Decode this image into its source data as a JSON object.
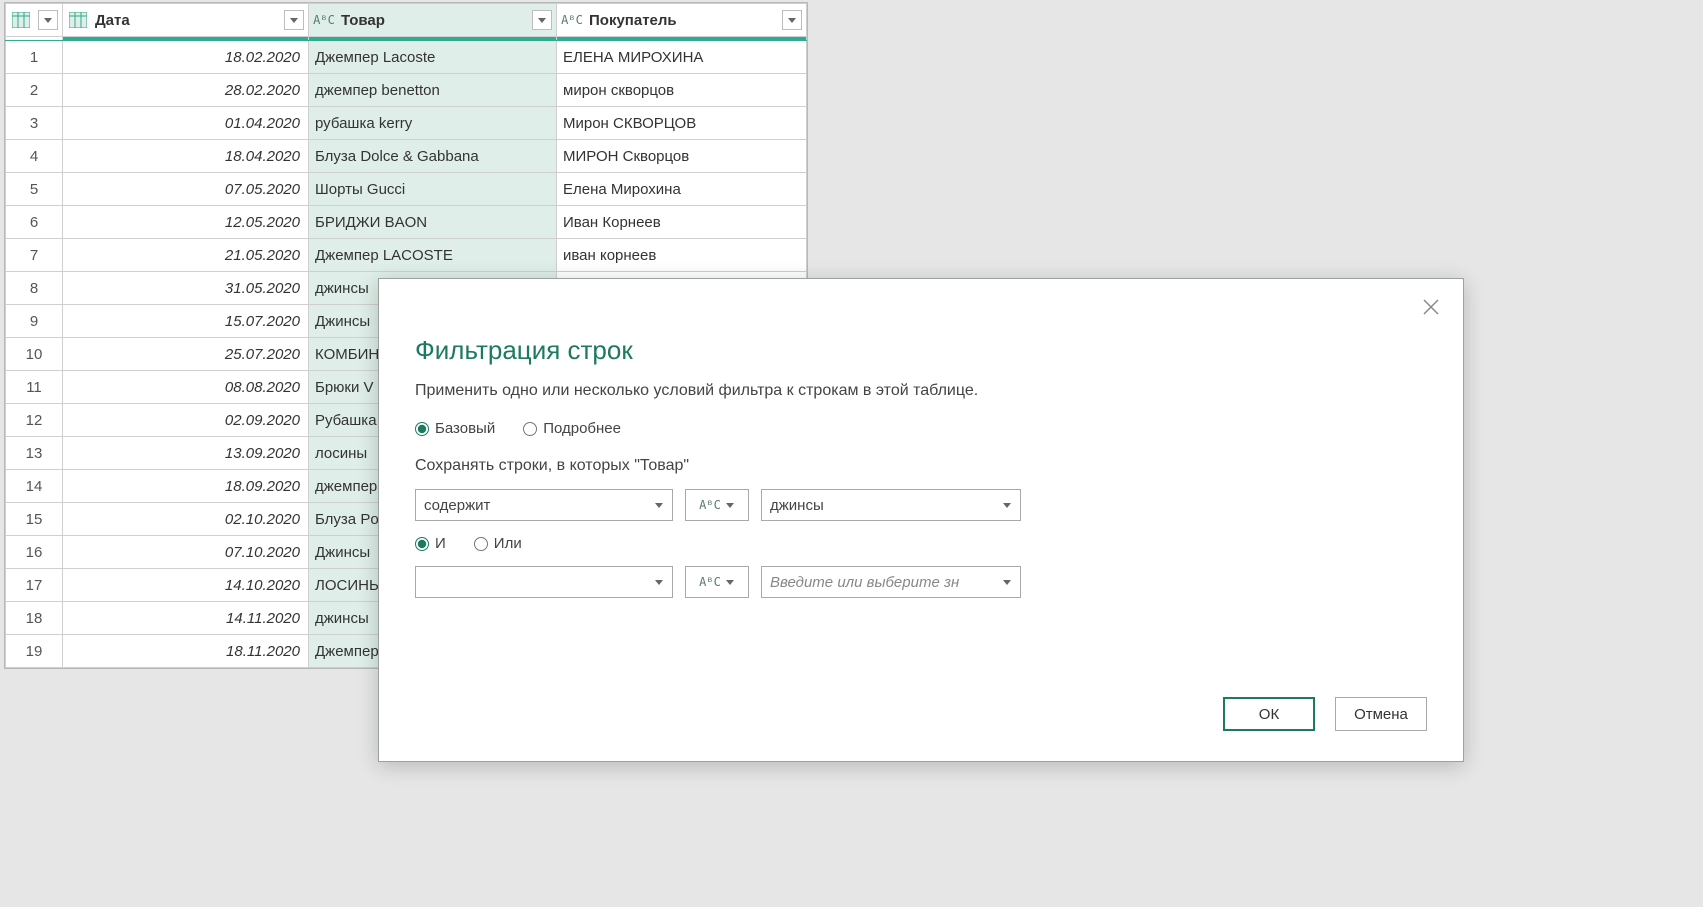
{
  "table": {
    "headers": {
      "date": "Дата",
      "product": "Товар",
      "customer": "Покупатель"
    },
    "rows": [
      {
        "n": "1",
        "date": "18.02.2020",
        "product": "Джемпер Lacoste",
        "customer": "ЕЛЕНА МИРОХИНА"
      },
      {
        "n": "2",
        "date": "28.02.2020",
        "product": "джемпер benetton",
        "customer": "мирон скворцов"
      },
      {
        "n": "3",
        "date": "01.04.2020",
        "product": "рубашка kerry",
        "customer": "Мирон СКВОРЦОВ"
      },
      {
        "n": "4",
        "date": "18.04.2020",
        "product": "Блуза Dolce & Gabbana",
        "customer": "МИРОН Скворцов"
      },
      {
        "n": "5",
        "date": "07.05.2020",
        "product": "Шорты Gucci",
        "customer": "Елена Мирохина"
      },
      {
        "n": "6",
        "date": "12.05.2020",
        "product": "БРИДЖИ BAON",
        "customer": "Иван Корнеев"
      },
      {
        "n": "7",
        "date": "21.05.2020",
        "product": "Джемпер LACOSTE",
        "customer": "иван корнеев"
      },
      {
        "n": "8",
        "date": "31.05.2020",
        "product": "джинсы ",
        "customer": ""
      },
      {
        "n": "9",
        "date": "15.07.2020",
        "product": "Джинсы ",
        "customer": ""
      },
      {
        "n": "10",
        "date": "25.07.2020",
        "product": "КОМБИН",
        "customer": ""
      },
      {
        "n": "11",
        "date": "08.08.2020",
        "product": "Брюки V",
        "customer": ""
      },
      {
        "n": "12",
        "date": "02.09.2020",
        "product": "Рубашка",
        "customer": ""
      },
      {
        "n": "13",
        "date": "13.09.2020",
        "product": "лосины ",
        "customer": ""
      },
      {
        "n": "14",
        "date": "18.09.2020",
        "product": "джемпер",
        "customer": ""
      },
      {
        "n": "15",
        "date": "02.10.2020",
        "product": "Блуза Po",
        "customer": ""
      },
      {
        "n": "16",
        "date": "07.10.2020",
        "product": "Джинсы ",
        "customer": ""
      },
      {
        "n": "17",
        "date": "14.10.2020",
        "product": "ЛОСИНЫ",
        "customer": ""
      },
      {
        "n": "18",
        "date": "14.11.2020",
        "product": "джинсы ",
        "customer": ""
      },
      {
        "n": "19",
        "date": "18.11.2020",
        "product": "Джемпер",
        "customer": ""
      }
    ]
  },
  "dialog": {
    "title": "Фильтрация строк",
    "subtitle": "Применить одно или несколько условий фильтра к строкам в этой таблице.",
    "mode": {
      "basic": "Базовый",
      "advanced": "Подробнее"
    },
    "keep_rows_label": "Сохранять строки, в которых \"Товар\"",
    "condition1": {
      "operator": "содержит",
      "value": "джинсы"
    },
    "logic": {
      "and": "И",
      "or": "Или"
    },
    "condition2": {
      "operator": "",
      "placeholder": "Введите или выберите зн"
    },
    "buttons": {
      "ok": "ОК",
      "cancel": "Отмена"
    },
    "abc_label": "AᴮC"
  }
}
